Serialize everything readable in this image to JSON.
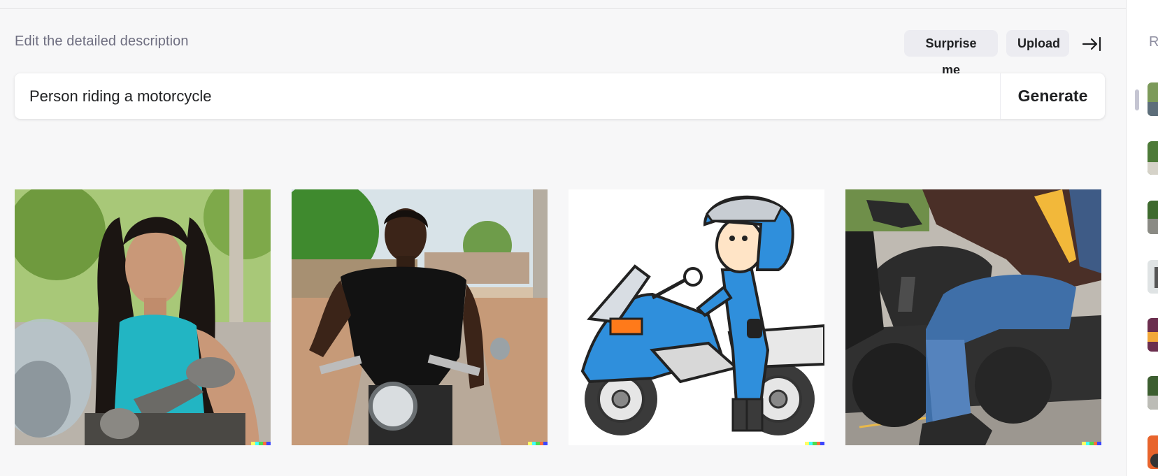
{
  "header": {
    "section_label": "Edit the detailed description",
    "surprise_label": "Surprise me",
    "upload_label": "Upload"
  },
  "prompt": {
    "value": "Person riding a motorcycle",
    "generate_label": "Generate"
  },
  "results": [
    {
      "subject": "woman in teal top beside motorcycle"
    },
    {
      "subject": "man in black t-shirt on motorcycle"
    },
    {
      "subject": "cartoon rider in blue suit beside blue motorcycle"
    },
    {
      "subject": "rider in jeans on black motorcycle"
    }
  ],
  "signature_colors": [
    "#ffff66",
    "#42ffff",
    "#51da4c",
    "#ff6e3c",
    "#3c46ff"
  ],
  "sidebar": {
    "title": "R",
    "thumb_count": 7
  },
  "colors": {
    "background": "#f7f7f8",
    "pill": "#ececf1",
    "text": "#202123",
    "muted": "#6e6e80"
  },
  "icons": {
    "collapse": "arrow-right-to-bar-icon"
  }
}
